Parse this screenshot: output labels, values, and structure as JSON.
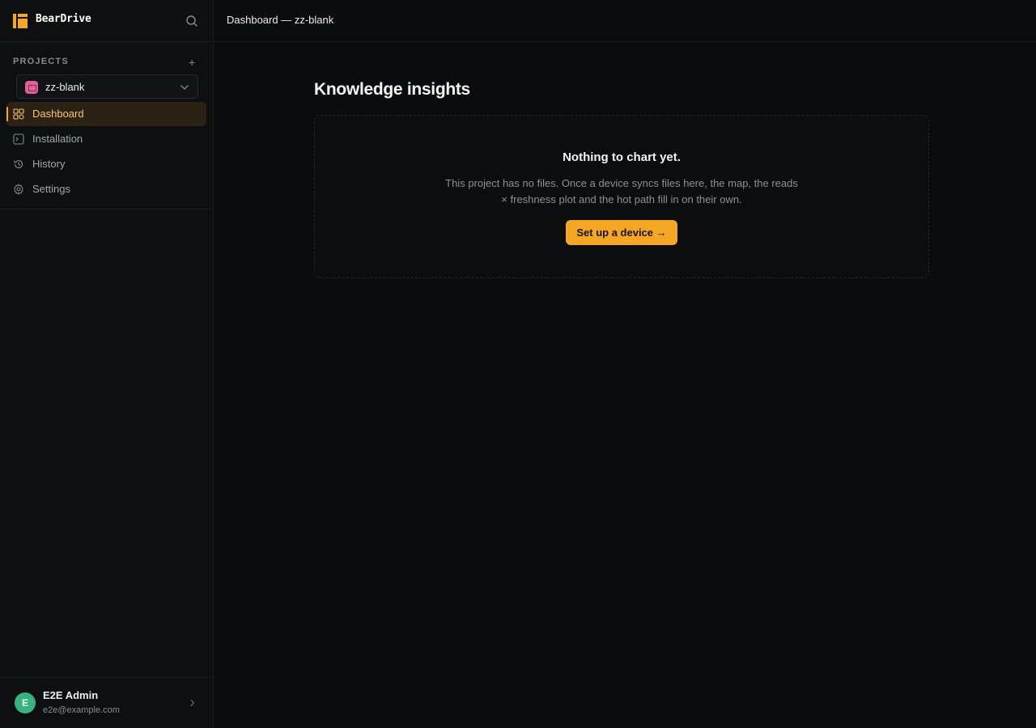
{
  "brand": {
    "name": "BearDrive",
    "logo": "beardrive-logo",
    "accent": "#f5a623"
  },
  "sidebar": {
    "search_icon": "search-icon",
    "projects_label": "PROJECTS",
    "add_project_icon": "+",
    "project_select": {
      "value": "zz-blank",
      "color": "#e0609a"
    },
    "items": [
      {
        "label": "Dashboard",
        "icon": "dashboard-grid-icon",
        "active": true
      },
      {
        "label": "Installation",
        "icon": "terminal-icon",
        "active": false
      },
      {
        "label": "History",
        "icon": "history-icon",
        "active": false
      },
      {
        "label": "Settings",
        "icon": "gear-icon",
        "active": false
      }
    ],
    "user": {
      "initial": "E",
      "name": "E2E Admin",
      "email": "e2e@example.com",
      "avatar_color": "#36b37e"
    }
  },
  "topbar": {
    "breadcrumb": "Dashboard — zz-blank"
  },
  "main": {
    "title": "Knowledge insights",
    "empty_state": {
      "heading": "Nothing to chart yet.",
      "description": "This project has no files. Once a device syncs files here, the map, the reads × freshness plot and the hot path fill in on their own.",
      "cta_label": "Set up a device →"
    }
  }
}
